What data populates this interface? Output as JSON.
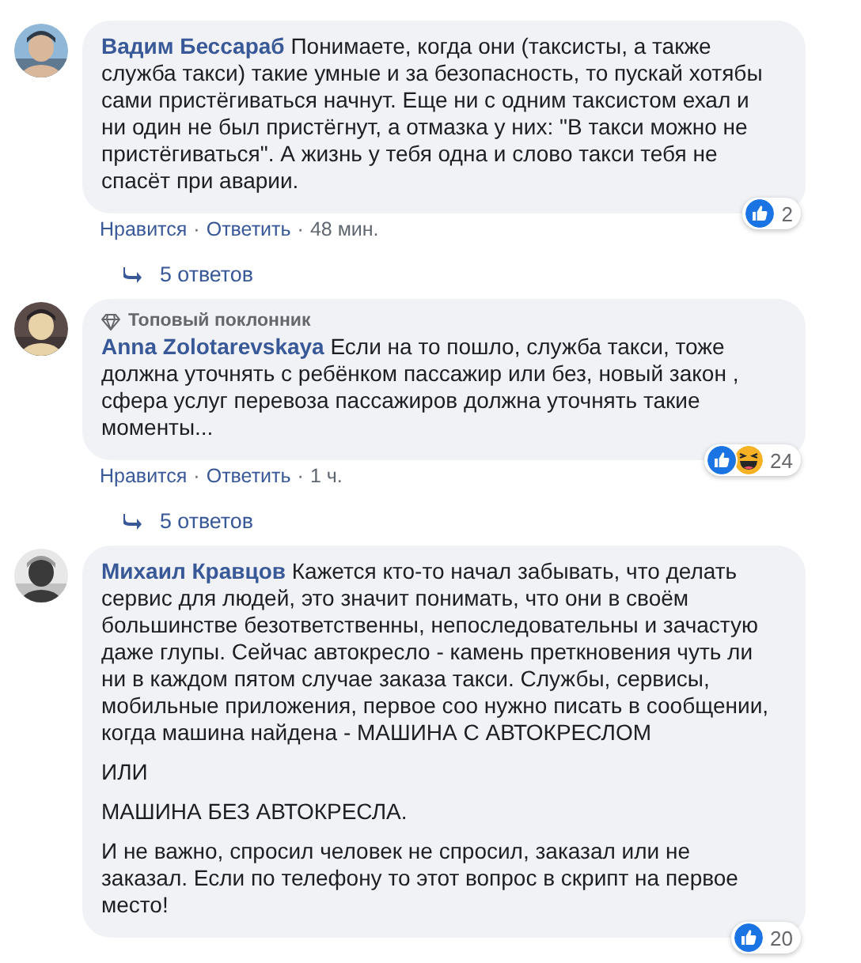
{
  "comments": [
    {
      "author": "Вадим Бессараб",
      "paragraphs": [
        "Понимаете, когда они (таксисты, а также служба такси) такие умные и за безопасность, то пускай хотябы сами пристёгиваться начнут. Еще ни с одним таксистом ехал и ни один не был пристёгнут, а отмазка у них: \"В такси можно не пристёгиваться\". А жизнь у тебя одна и слово такси тебя не спасёт при аварии."
      ],
      "reactions": [
        {
          "kind": "like"
        }
      ],
      "reaction_count": "2",
      "actions": [
        "Нравится",
        "·",
        "Ответить",
        "·"
      ],
      "time": "48 мин.",
      "replies": "5 ответов"
    },
    {
      "author": "Anna Zolotarevskaya",
      "badge": "Топовый поклонник",
      "paragraphs": [
        "Если на то пошло, служба такси, тоже должна уточнять с ребёнком пассажир или без, новый закон , сфера услуг перевоза пассажиров должна уточнять такие моменты..."
      ],
      "reactions": [
        {
          "kind": "like"
        },
        {
          "kind": "haha"
        }
      ],
      "reaction_count": "24",
      "actions": [
        "Нравится",
        "·",
        "Ответить",
        "·"
      ],
      "time": "1 ч.",
      "replies": "5 ответов"
    },
    {
      "author": "Михаил Кравцов",
      "paragraphs": [
        "Кажется кто-то начал забывать, что делать сервис для людей, это значит понимать, что они в своём большинстве безответственны, непоследовательны и зачастую даже глупы. Сейчас автокресло - камень преткновения чуть ли ни в каждом пятом случае заказа такси. Службы, сервисы, мобильные приложения, первое соо нужно писать в сообщении, когда машина найдена - МАШИНА С АВТОКРЕСЛОМ",
        "ИЛИ",
        "МАШИНА БЕЗ АВТОКРЕСЛА.",
        "И не важно, спросил человек не спросил, заказал или не заказал. Если по телефону то этот вопрос в скрипт на первое место!"
      ],
      "reactions": [
        {
          "kind": "like"
        }
      ],
      "reaction_count": "20"
    }
  ]
}
